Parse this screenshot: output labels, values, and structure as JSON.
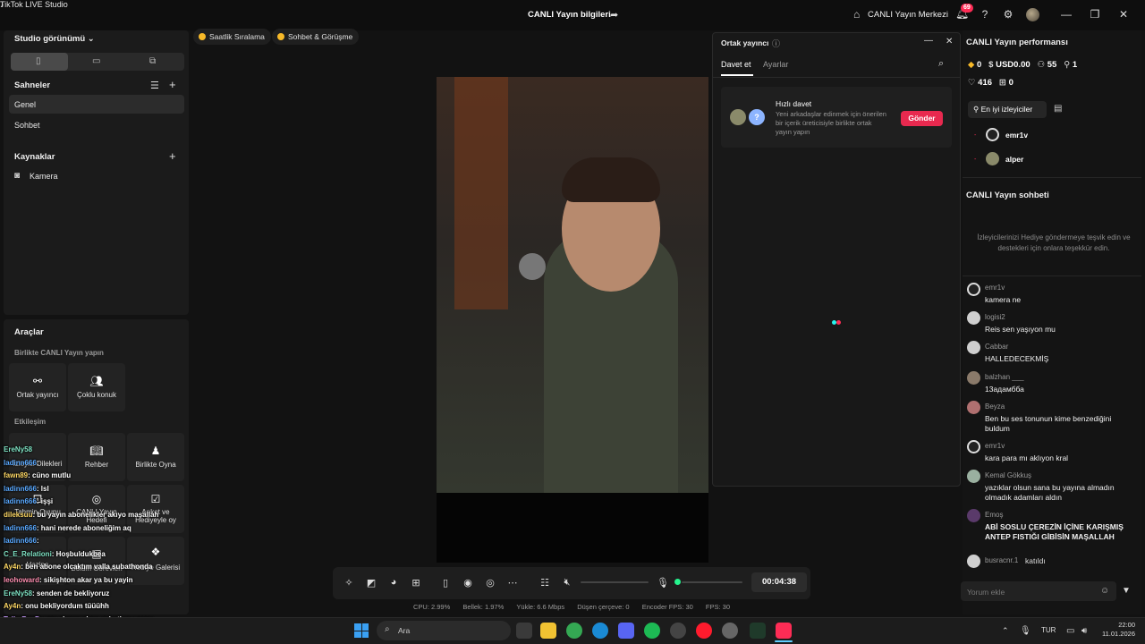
{
  "titlebar": {
    "app_name": "TikTok LIVE Studio",
    "center_title": "CANLI Yayın bilgileri",
    "live_center": "CANLI Yayın Merkezi",
    "notif_count": "69"
  },
  "left": {
    "studio_view": "Studio görünümü",
    "scenes_title": "Sahneler",
    "scenes": [
      "Genel",
      "Sohbet"
    ],
    "sources_title": "Kaynaklar",
    "sources": [
      "Kamera"
    ]
  },
  "tools": {
    "title": "Araçlar",
    "together_title": "Birlikte CANLI Yayın yapın",
    "together_items": [
      "Ortak yayıncı",
      "Çoklu konuk"
    ],
    "interaction_title": "Etkileşim",
    "interaction_items": [
      "İzleyici Dilekleri",
      "Rehber",
      "Birlikte Oyna",
      "Tahmin Oyunu",
      "CANLI Yayın Hedefi",
      "Anket ve Hediyeyle oy",
      "Hazine",
      "Bölüm Görevleri",
      "Hediye Galerisi"
    ]
  },
  "pills": [
    "Saatlik Sıralama",
    "Sohbet & Görüşme"
  ],
  "cohost": {
    "title": "Ortak yayıncı",
    "tab_invite": "Davet et",
    "tab_settings": "Ayarlar",
    "quick_title": "Hızlı davet",
    "quick_desc": "Yeni arkadaşlar edinmek için önerilen bir içerik üreticisiyle birlikte ortak yayın yapın",
    "send_label": "Gönder"
  },
  "right": {
    "perf_title": "CANLI Yayın performansı",
    "stats": {
      "coins": "0",
      "usd": "USD0.00",
      "viewers": "55",
      "new": "1",
      "likes": "416",
      "gifts": "0"
    },
    "top_viewers_label": "En iyi izleyiciler",
    "top_viewers": [
      "emr1v",
      "alper"
    ],
    "chat_title": "CANLI Yayın sohbeti",
    "chat_hint": "İzleyicilerinizi Hediye göndermeye teşvik edin ve destekleri için onlara teşekkür edin.",
    "chat_messages": [
      {
        "name": "emr1v",
        "msg": "kamera ne"
      },
      {
        "name": "logisi2",
        "msg": "Reis sen yaşıyon mu"
      },
      {
        "name": "Cabbar",
        "msg": "HALLEDECEKMİŞ"
      },
      {
        "name": "balzhan ___",
        "msg": "13адамбба"
      },
      {
        "name": "Beyza",
        "msg": "Ben bu ses tonunun kime benzediğini buldum"
      },
      {
        "name": "emr1v",
        "msg": "kara para mı aklıyon kral"
      },
      {
        "name": "Kemal Gökkuş",
        "msg": "yazıklar olsun sana bu yayına almadın olmadık adamları aldın"
      },
      {
        "name": "Emoş",
        "msg": "ABİ SOSLU ÇEREZİN İÇİNE KARIŞMIŞ ANTEP FISTIĞI GİBİSİN MAŞALLAH"
      }
    ],
    "last_line_name": "busracnr.1",
    "last_line_msg": "katıldı",
    "comment_placeholder": "Yorum ekle"
  },
  "controls": {
    "timer": "00:04:38"
  },
  "status": {
    "cpu": "CPU: 2.99%",
    "mem": "Bellek: 1.97%",
    "upload": "Yükle: 6.6 Mbps",
    "dropped": "Düşen çerçeve: 0",
    "enc_fps": "Encoder FPS: 30",
    "fps": "FPS: 30"
  },
  "overlay_chat": [
    {
      "user": "EreNy58",
      "text": "",
      "color": "#7fe3c4"
    },
    {
      "user": "ladinn666",
      "text": ": ",
      "color": "#5aa9ff"
    },
    {
      "user": "fawn89",
      "text": ": cüno mutlu",
      "color": "#ffd966"
    },
    {
      "user": "ladinn666",
      "text": ": lsl",
      "color": "#5aa9ff"
    },
    {
      "user": "ladinn666",
      "text": ": işşi",
      "color": "#5aa9ff"
    },
    {
      "user": "dileksuu",
      "text": ": bu yayın abonelikler akıyo maşallah",
      "color": "#ffd966"
    },
    {
      "user": "ladinn666",
      "text": ": hani nerede aboneliğim aq",
      "color": "#5aa9ff"
    },
    {
      "user": "ladinn666",
      "text": ":",
      "color": "#5aa9ff"
    },
    {
      "user": "C_E_Relationi",
      "text": ": Hoşbuldukbea",
      "color": "#7fe3c4"
    },
    {
      "user": "Ay4n",
      "text": ": ben abone olcaktım valla subathonda",
      "color": "#ffd966"
    },
    {
      "user": "leohoward",
      "text": ": sikişhton akar ya bu yayin",
      "color": "#ff8fb1"
    },
    {
      "user": "EreNy58",
      "text": ": senden de bekliyoruz",
      "color": "#7fe3c4"
    },
    {
      "user": "Ay4n",
      "text": ": onu bekliyordum tüüühh",
      "color": "#ffd966"
    },
    {
      "user": "TalhaBaşD",
      "text": ": yap abone olam subathon varsa",
      "color": "#c79bff"
    },
    {
      "user": "Cagriacil06",
      "text": ": 2 haftalık tatil geliyo",
      "color": "#5aa9ff"
    }
  ],
  "taskbar": {
    "search": "Ara",
    "lang": "TUR",
    "time": "22:00",
    "date": "11.01.2026"
  }
}
